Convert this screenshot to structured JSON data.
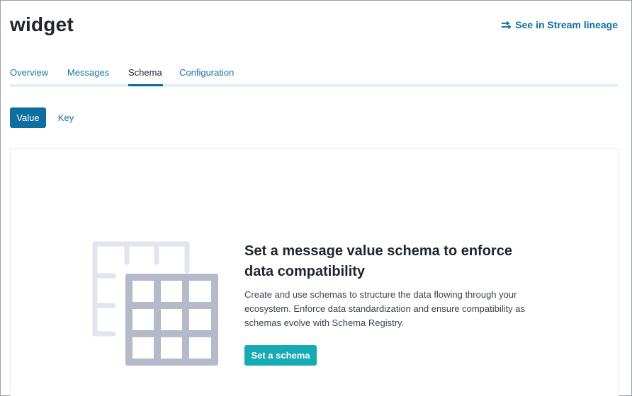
{
  "header": {
    "title": "widget",
    "lineage_link": {
      "label": "See in Stream lineage",
      "icon": "stream-lineage-icon"
    }
  },
  "tabs": [
    {
      "label": "Overview",
      "active": false
    },
    {
      "label": "Messages",
      "active": false
    },
    {
      "label": "Schema",
      "active": true
    },
    {
      "label": "Configuration",
      "active": false
    }
  ],
  "schema_type_toggle": {
    "options": [
      {
        "label": "Value",
        "selected": true
      },
      {
        "label": "Key",
        "selected": false
      }
    ]
  },
  "empty_state": {
    "illustration": "schema-table-icon",
    "heading": "Set a message value schema to enforce data compatibility",
    "body": "Create and use schemas to structure the data flowing through your ecosystem. Enforce data standardization and ensure compatibility as schemas evolve with Schema Registry.",
    "cta_label": "Set a schema"
  },
  "colors": {
    "accent": "#0c6fa0",
    "cta": "#15aab4",
    "tab_track": "#e3f0f7",
    "illustration_back": "#e2e4ee",
    "illustration_front": "#b5bac9"
  }
}
